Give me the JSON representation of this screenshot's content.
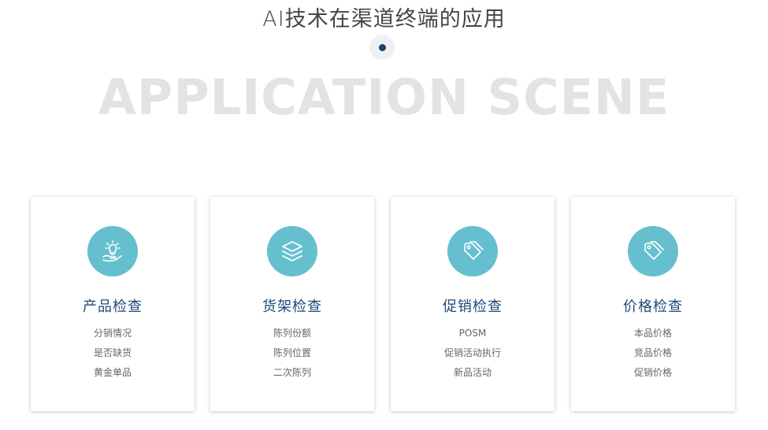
{
  "header": {
    "title": "AI技术在渠道终端的应用",
    "watermark": "APPLICATION SCENE"
  },
  "colors": {
    "accent": "#66bfcf",
    "title_blue": "#1f4a7a",
    "dot": "#1d3f74",
    "watermark": "#e3e3e3"
  },
  "cards": [
    {
      "icon": "lightbulb-hand-icon",
      "title": "产品检查",
      "items": [
        "分销情况",
        "是否缺货",
        "黄金单品"
      ]
    },
    {
      "icon": "layers-icon",
      "title": "货架检查",
      "items": [
        "陈列份额",
        "陈列位置",
        "二次陈列"
      ]
    },
    {
      "icon": "tags-icon",
      "title": "促销检查",
      "items": [
        "POSM",
        "促销活动执行",
        "新品活动"
      ]
    },
    {
      "icon": "tags-icon",
      "title": "价格检查",
      "items": [
        "本品价格",
        "竞品价格",
        "促销价格"
      ]
    }
  ]
}
